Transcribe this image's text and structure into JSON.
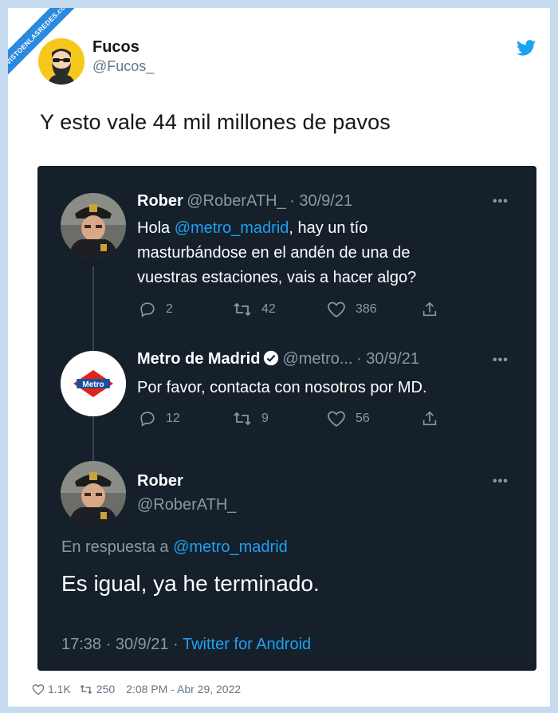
{
  "watermark": "VISTOENLASREDES.com",
  "author": {
    "name": "Fucos",
    "handle": "@Fucos_"
  },
  "tweet_text": "Y esto vale 44 mil millones de pavos",
  "embedded": {
    "tweet1": {
      "name": "Rober",
      "handle": "@RoberATH_",
      "date": "· 30/9/21",
      "text_before": "Hola ",
      "mention": "@metro_madrid",
      "text_after": ", hay un tío masturbándose en el andén de una de vuestras estaciones, vais a hacer algo?",
      "line1_after": ", hay un tío",
      "line2": "masturbándose en el andén de una de",
      "line3": "vuestras estaciones, vais a hacer algo?",
      "replies": "2",
      "retweets": "42",
      "likes": "386"
    },
    "tweet2": {
      "name": "Metro de Madrid",
      "handle": "@metro...",
      "date": "· 30/9/21",
      "text": "Por favor, contacta con nosotros por MD.",
      "logo_text": "Metro",
      "replies": "12",
      "retweets": "9",
      "likes": "56"
    },
    "tweet3": {
      "name": "Rober",
      "handle": "@RoberATH_",
      "reply_prefix": "En respuesta a ",
      "reply_mention": "@metro_madrid",
      "text": "Es igual, ya he terminado.",
      "time": "17:38 · 30/9/21 · ",
      "client": "Twitter for Android"
    }
  },
  "footer": {
    "likes": "1.1K",
    "retweets": "250",
    "timestamp": "2:08 PM - Abr 29, 2022"
  },
  "colors": {
    "accent": "#1da1f2",
    "dark_bg": "#15202b",
    "muted": "#8899a6"
  }
}
